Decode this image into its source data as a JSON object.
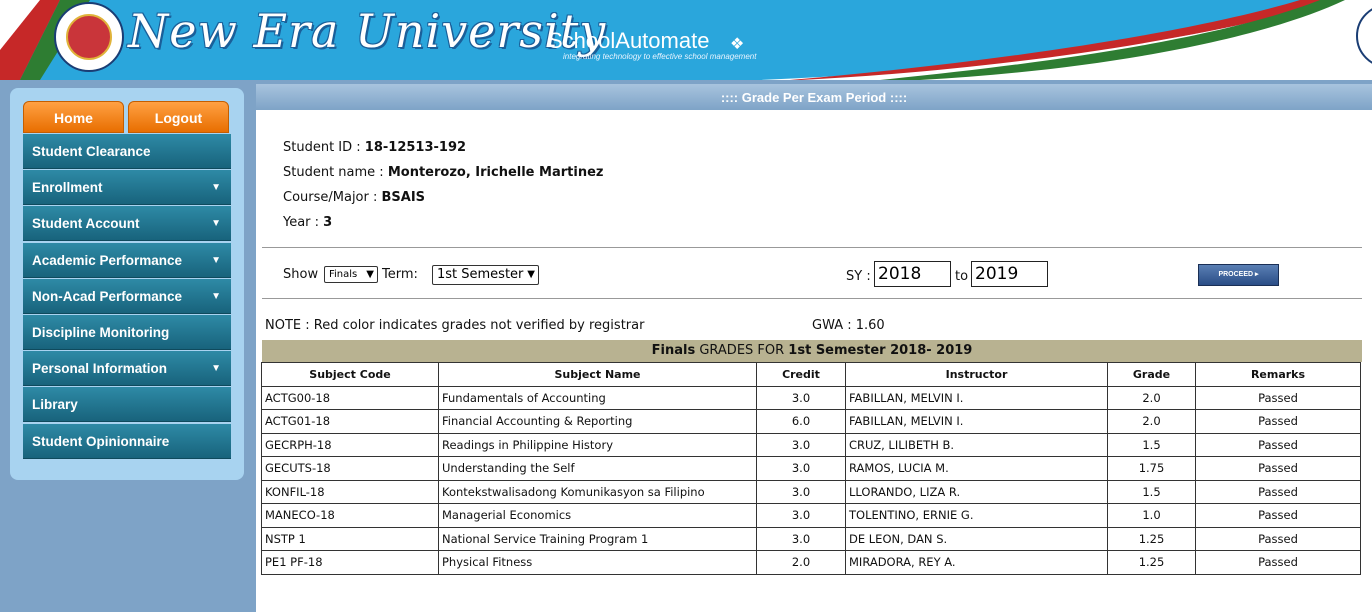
{
  "header": {
    "university_name": "New Era University",
    "brand": "SchoolAutomate",
    "tagline": "integrating technology to effective school management"
  },
  "sidebar": {
    "home_label": "Home",
    "logout_label": "Logout",
    "items": [
      {
        "label": "Student Clearance",
        "arrow": ""
      },
      {
        "label": "Enrollment",
        "arrow": "▼"
      },
      {
        "label": "Student Account",
        "arrow": "▼"
      },
      {
        "label": "Academic Performance",
        "arrow": "▼"
      },
      {
        "label": "Non-Acad Performance",
        "arrow": "▼"
      },
      {
        "label": "Discipline Monitoring",
        "arrow": ""
      },
      {
        "label": "Personal Information",
        "arrow": "▼"
      },
      {
        "label": "Library",
        "arrow": ""
      },
      {
        "label": "Student Opinionnaire",
        "arrow": ""
      }
    ]
  },
  "page": {
    "title": ":::: Grade Per Exam Period ::::"
  },
  "student": {
    "id_label": "Student ID : ",
    "id": "18-12513-192",
    "name_label": "Student name : ",
    "name": "Monterozo, Irichelle Martinez",
    "course_label": "Course/Major : ",
    "course": "BSAIS",
    "year_label": "Year : ",
    "year": "3"
  },
  "filters": {
    "show_label": "Show",
    "show_value": "Finals",
    "term_label": "Term:",
    "term_value": "1st Semester",
    "sy_label": "SY :",
    "sy_from": "2018",
    "to_label": "to",
    "sy_to": "2019",
    "proceed_label": "PROCEED ▸"
  },
  "note": "NOTE : Red color indicates grades not verified by registrar",
  "gwa": "GWA : 1.60",
  "grades_bar": {
    "period": "Finals",
    "mid": " GRADES FOR ",
    "term": "1st Semester 2018- 2019"
  },
  "table": {
    "headers": [
      "Subject Code",
      "Subject Name",
      "Credit",
      "Instructor",
      "Grade",
      "Remarks"
    ],
    "rows": [
      [
        "ACTG00-18",
        "Fundamentals of Accounting",
        "3.0",
        "FABILLAN, MELVIN I.",
        "2.0",
        "Passed"
      ],
      [
        "ACTG01-18",
        "Financial Accounting & Reporting",
        "6.0",
        "FABILLAN, MELVIN I.",
        "2.0",
        "Passed"
      ],
      [
        "GECRPH-18",
        "Readings in Philippine History",
        "3.0",
        "CRUZ, LILIBETH B.",
        "1.5",
        "Passed"
      ],
      [
        "GECUTS-18",
        "Understanding the Self",
        "3.0",
        "RAMOS, LUCIA M.",
        "1.75",
        "Passed"
      ],
      [
        "KONFIL-18",
        "Kontekstwalisadong Komunikasyon sa Filipino",
        "3.0",
        "LLORANDO, LIZA R.",
        "1.5",
        "Passed"
      ],
      [
        "MANECO-18",
        "Managerial Economics",
        "3.0",
        "TOLENTINO, ERNIE G.",
        "1.0",
        "Passed"
      ],
      [
        "NSTP 1",
        "National Service Training Program 1",
        "3.0",
        "DE LEON, DAN S.",
        "1.25",
        "Passed"
      ],
      [
        "PE1 PF-18",
        "Physical Fitness",
        "2.0",
        "MIRADORA, REY A.",
        "1.25",
        "Passed"
      ]
    ]
  }
}
